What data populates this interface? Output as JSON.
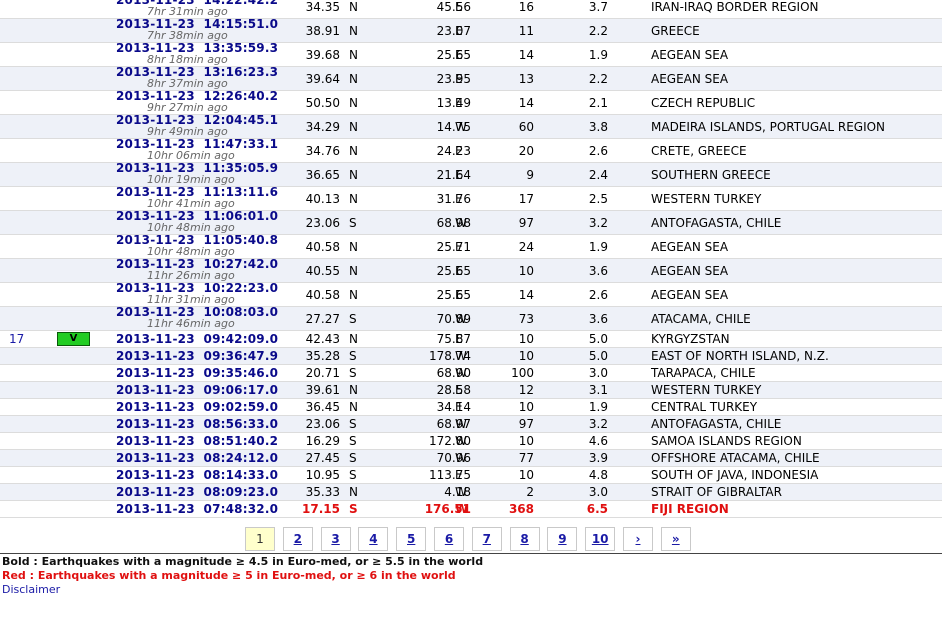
{
  "rows": [
    {
      "num": "",
      "badge": "",
      "date": "2013-11-23",
      "time": "14:22:42.2",
      "ago": "7hr 31min ago",
      "lat": "34.35",
      "ns": "N",
      "lon": "45.56",
      "ew": "E",
      "depth": "16",
      "mag": "3.7",
      "region": "IRAN-IRAQ BORDER REGION"
    },
    {
      "num": "",
      "badge": "",
      "date": "2013-11-23",
      "time": "14:15:51.0",
      "ago": "7hr 38min ago",
      "lat": "38.91",
      "ns": "N",
      "lon": "23.07",
      "ew": "E",
      "depth": "11",
      "mag": "2.2",
      "region": "GREECE"
    },
    {
      "num": "",
      "badge": "",
      "date": "2013-11-23",
      "time": "13:35:59.3",
      "ago": "8hr 18min ago",
      "lat": "39.68",
      "ns": "N",
      "lon": "25.65",
      "ew": "E",
      "depth": "14",
      "mag": "1.9",
      "region": "AEGEAN SEA"
    },
    {
      "num": "",
      "badge": "",
      "date": "2013-11-23",
      "time": "13:16:23.3",
      "ago": "8hr 37min ago",
      "lat": "39.64",
      "ns": "N",
      "lon": "23.95",
      "ew": "E",
      "depth": "13",
      "mag": "2.2",
      "region": "AEGEAN SEA"
    },
    {
      "num": "",
      "badge": "",
      "date": "2013-11-23",
      "time": "12:26:40.2",
      "ago": "9hr 27min ago",
      "lat": "50.50",
      "ns": "N",
      "lon": "13.49",
      "ew": "E",
      "depth": "14",
      "mag": "2.1",
      "region": "CZECH REPUBLIC"
    },
    {
      "num": "",
      "badge": "",
      "date": "2013-11-23",
      "time": "12:04:45.1",
      "ago": "9hr 49min ago",
      "lat": "34.29",
      "ns": "N",
      "lon": "14.75",
      "ew": "W",
      "depth": "60",
      "mag": "3.8",
      "region": "MADEIRA ISLANDS, PORTUGAL REGION"
    },
    {
      "num": "",
      "badge": "",
      "date": "2013-11-23",
      "time": "11:47:33.1",
      "ago": "10hr 06min ago",
      "lat": "34.76",
      "ns": "N",
      "lon": "24.23",
      "ew": "E",
      "depth": "20",
      "mag": "2.6",
      "region": "CRETE, GREECE"
    },
    {
      "num": "",
      "badge": "",
      "date": "2013-11-23",
      "time": "11:35:05.9",
      "ago": "10hr 19min ago",
      "lat": "36.65",
      "ns": "N",
      "lon": "21.64",
      "ew": "E",
      "depth": "9",
      "mag": "2.4",
      "region": "SOUTHERN GREECE"
    },
    {
      "num": "",
      "badge": "",
      "date": "2013-11-23",
      "time": "11:13:11.6",
      "ago": "10hr 41min ago",
      "lat": "40.13",
      "ns": "N",
      "lon": "31.76",
      "ew": "E",
      "depth": "17",
      "mag": "2.5",
      "region": "WESTERN TURKEY"
    },
    {
      "num": "",
      "badge": "",
      "date": "2013-11-23",
      "time": "11:06:01.0",
      "ago": "10hr 48min ago",
      "lat": "23.06",
      "ns": "S",
      "lon": "68.98",
      "ew": "W",
      "depth": "97",
      "mag": "3.2",
      "region": "ANTOFAGASTA, CHILE"
    },
    {
      "num": "",
      "badge": "",
      "date": "2013-11-23",
      "time": "11:05:40.8",
      "ago": "10hr 48min ago",
      "lat": "40.58",
      "ns": "N",
      "lon": "25.71",
      "ew": "E",
      "depth": "24",
      "mag": "1.9",
      "region": "AEGEAN SEA"
    },
    {
      "num": "",
      "badge": "",
      "date": "2013-11-23",
      "time": "10:27:42.0",
      "ago": "11hr 26min ago",
      "lat": "40.55",
      "ns": "N",
      "lon": "25.65",
      "ew": "E",
      "depth": "10",
      "mag": "3.6",
      "region": "AEGEAN SEA"
    },
    {
      "num": "",
      "badge": "",
      "date": "2013-11-23",
      "time": "10:22:23.0",
      "ago": "11hr 31min ago",
      "lat": "40.58",
      "ns": "N",
      "lon": "25.65",
      "ew": "E",
      "depth": "14",
      "mag": "2.6",
      "region": "AEGEAN SEA"
    },
    {
      "num": "",
      "badge": "",
      "date": "2013-11-23",
      "time": "10:08:03.0",
      "ago": "11hr 46min ago",
      "lat": "27.27",
      "ns": "S",
      "lon": "70.89",
      "ew": "W",
      "depth": "73",
      "mag": "3.6",
      "region": "ATACAMA, CHILE"
    },
    {
      "num": "17",
      "badge": "V",
      "date": "2013-11-23",
      "time": "09:42:09.0",
      "ago": "",
      "lat": "42.43",
      "ns": "N",
      "lon": "75.87",
      "ew": "E",
      "depth": "10",
      "mag": "5.0",
      "region": "KYRGYZSTAN"
    },
    {
      "num": "",
      "badge": "",
      "date": "2013-11-23",
      "time": "09:36:47.9",
      "ago": "",
      "lat": "35.28",
      "ns": "S",
      "lon": "178.74",
      "ew": "W",
      "depth": "10",
      "mag": "5.0",
      "region": "EAST OF NORTH ISLAND, N.Z."
    },
    {
      "num": "",
      "badge": "",
      "date": "2013-11-23",
      "time": "09:35:46.0",
      "ago": "",
      "lat": "20.71",
      "ns": "S",
      "lon": "68.90",
      "ew": "W",
      "depth": "100",
      "mag": "3.0",
      "region": "TARAPACA, CHILE"
    },
    {
      "num": "",
      "badge": "",
      "date": "2013-11-23",
      "time": "09:06:17.0",
      "ago": "",
      "lat": "39.61",
      "ns": "N",
      "lon": "28.58",
      "ew": "E",
      "depth": "12",
      "mag": "3.1",
      "region": "WESTERN TURKEY"
    },
    {
      "num": "",
      "badge": "",
      "date": "2013-11-23",
      "time": "09:02:59.0",
      "ago": "",
      "lat": "36.45",
      "ns": "N",
      "lon": "34.14",
      "ew": "E",
      "depth": "10",
      "mag": "1.9",
      "region": "CENTRAL TURKEY"
    },
    {
      "num": "",
      "badge": "",
      "date": "2013-11-23",
      "time": "08:56:33.0",
      "ago": "",
      "lat": "23.06",
      "ns": "S",
      "lon": "68.97",
      "ew": "W",
      "depth": "97",
      "mag": "3.2",
      "region": "ANTOFAGASTA, CHILE"
    },
    {
      "num": "",
      "badge": "",
      "date": "2013-11-23",
      "time": "08:51:40.2",
      "ago": "",
      "lat": "16.29",
      "ns": "S",
      "lon": "172.80",
      "ew": "W",
      "depth": "10",
      "mag": "4.6",
      "region": "SAMOA ISLANDS REGION"
    },
    {
      "num": "",
      "badge": "",
      "date": "2013-11-23",
      "time": "08:24:12.0",
      "ago": "",
      "lat": "27.45",
      "ns": "S",
      "lon": "70.96",
      "ew": "W",
      "depth": "77",
      "mag": "3.9",
      "region": "OFFSHORE ATACAMA, CHILE"
    },
    {
      "num": "",
      "badge": "",
      "date": "2013-11-23",
      "time": "08:14:33.0",
      "ago": "",
      "lat": "10.95",
      "ns": "S",
      "lon": "113.75",
      "ew": "E",
      "depth": "10",
      "mag": "4.8",
      "region": "SOUTH OF JAVA, INDONESIA"
    },
    {
      "num": "",
      "badge": "",
      "date": "2013-11-23",
      "time": "08:09:23.0",
      "ago": "",
      "lat": "35.33",
      "ns": "N",
      "lon": "4.18",
      "ew": "W",
      "depth": "2",
      "mag": "3.0",
      "region": "STRAIT OF GIBRALTAR"
    },
    {
      "num": "",
      "badge": "",
      "date": "2013-11-23",
      "time": "07:48:32.0",
      "ago": "",
      "lat": "17.15",
      "ns": "S",
      "lon": "176.51",
      "ew": "W",
      "depth": "368",
      "mag": "6.5",
      "region": "FIJI REGION",
      "red": true
    }
  ],
  "pagination": {
    "current": "1",
    "pages": [
      "1",
      "2",
      "3",
      "4",
      "5",
      "6",
      "7",
      "8",
      "9",
      "10"
    ],
    "next": "›",
    "last": "»"
  },
  "legend": {
    "bold": "Bold : Earthquakes with a magnitude ≥ 4.5 in Euro-med, or ≥ 5.5 in the world",
    "red": "Red : Earthquakes with a magnitude ≥ 5 in Euro-med, or ≥ 6 in the world",
    "disclaimer": "Disclaimer"
  },
  "colors": {
    "badge_green": "#22cc22",
    "date_blue": "#0a0a8a",
    "link_blue": "#1a1aa6",
    "alert_red": "#e01010",
    "stripe": "#eef1f8"
  }
}
